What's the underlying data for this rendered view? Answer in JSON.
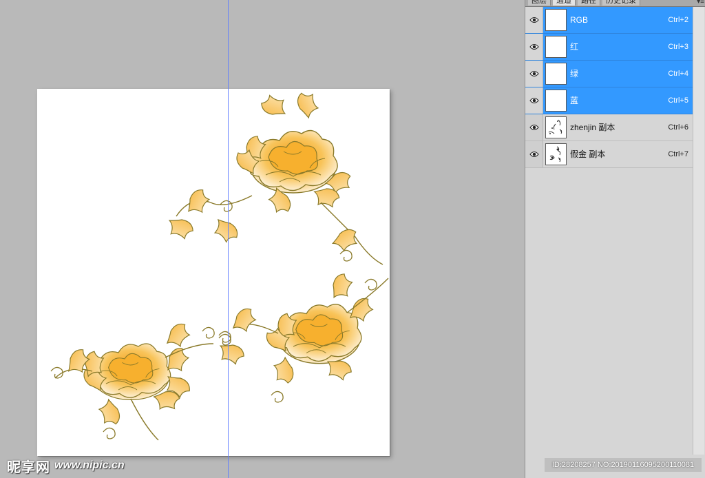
{
  "panel": {
    "tabs": [
      {
        "label": "图层",
        "active": false
      },
      {
        "label": "通道",
        "active": true
      },
      {
        "label": "路径",
        "active": false
      },
      {
        "label": "历史记录",
        "active": false
      }
    ],
    "menu_icon": "panel-menu-icon",
    "channels": [
      {
        "name": "RGB",
        "shortcut": "Ctrl+2",
        "selected": true,
        "visible": true
      },
      {
        "name": "红",
        "shortcut": "Ctrl+3",
        "selected": true,
        "visible": true
      },
      {
        "name": "绿",
        "shortcut": "Ctrl+4",
        "selected": true,
        "visible": true
      },
      {
        "name": "蓝",
        "shortcut": "Ctrl+5",
        "selected": true,
        "visible": true
      },
      {
        "name": "zhenjin 副本",
        "shortcut": "Ctrl+6",
        "selected": false,
        "visible": true
      },
      {
        "name": "假金 副本",
        "shortcut": "Ctrl+7",
        "selected": false,
        "visible": true
      }
    ]
  },
  "watermark": {
    "brand": "昵享网",
    "url": "www.nipic.cn",
    "info": "ID:28208257 NO:20190116095200110081"
  },
  "colors": {
    "selection": "#3399ff",
    "guide": "#5e7cff",
    "flower_gold": "#f4a41c",
    "outline": "#8a7a2a"
  }
}
